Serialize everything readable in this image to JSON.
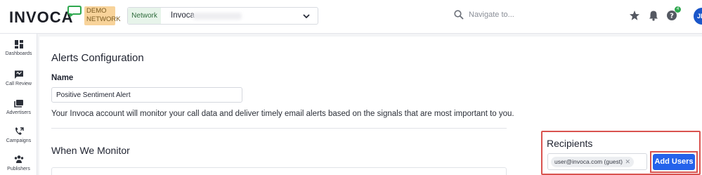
{
  "app": {
    "logo_text": "INVOCA",
    "demo_badge": "DEMO NETWORK"
  },
  "header": {
    "network_tag": "Network",
    "network_value": "Invoca",
    "search_placeholder": "Navigate to...",
    "help_count": "4",
    "avatar_initials": "JE"
  },
  "sidebar": {
    "items": [
      {
        "label": "Dashboards",
        "icon": "dashboard-icon"
      },
      {
        "label": "Call Review",
        "icon": "call-review-icon"
      },
      {
        "label": "Advertisers",
        "icon": "advertisers-icon"
      },
      {
        "label": "Campaigns",
        "icon": "campaigns-icon"
      },
      {
        "label": "Publishers",
        "icon": "publishers-icon"
      }
    ]
  },
  "main": {
    "title": "Alerts Configuration",
    "name_label": "Name",
    "name_value": "Positive Sentiment Alert",
    "description": "Your Invoca account will monitor your call data and deliver timely email alerts based on the signals that are most important to you.",
    "section_title": "When We Monitor"
  },
  "recipients": {
    "title": "Recipients",
    "chips": [
      "user@invoca.com (guest)"
    ],
    "add_button": "Add Users"
  },
  "colors": {
    "accent": "#2563eb",
    "highlight_border": "#d9534f",
    "demo_badge_bg": "#f8d39a",
    "network_tag_bg": "#e7f4ea",
    "logo_bubble": "#2fa84f"
  }
}
